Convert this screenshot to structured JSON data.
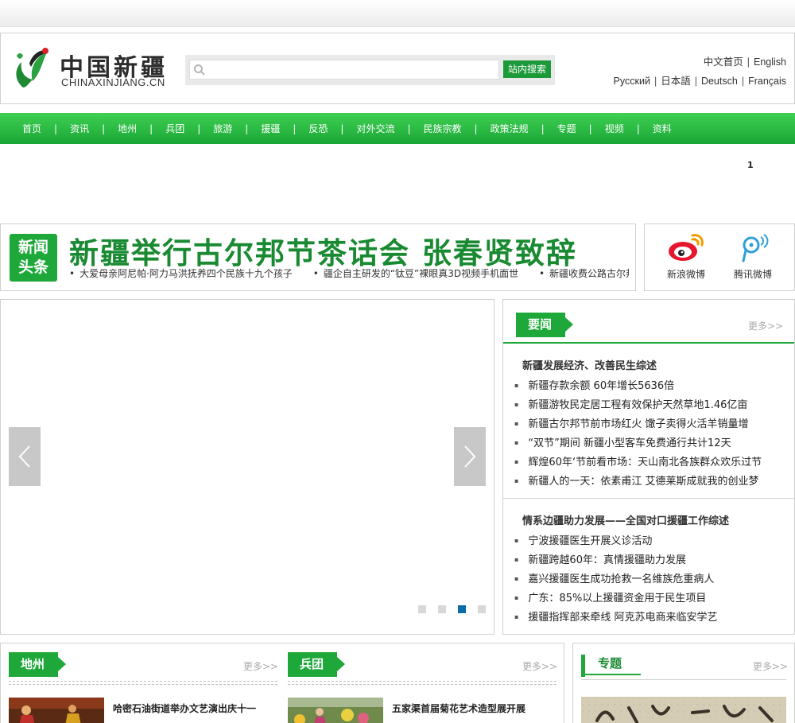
{
  "header": {
    "logo_cn": "中国新疆",
    "logo_en": "CHINAXINJIANG.CN",
    "search_button": "站内搜索",
    "search_placeholder": "",
    "lang_row1": [
      "中文首页",
      "English"
    ],
    "lang_row2": [
      "Русский",
      "日本語",
      "Deutsch",
      "Français"
    ]
  },
  "nav": [
    "首页",
    "资讯",
    "地州",
    "兵团",
    "旅游",
    "援疆",
    "反恐",
    "对外交流",
    "民族宗教",
    "政策法规",
    "专题",
    "视频",
    "资料"
  ],
  "pager": "1",
  "headline": {
    "badge_line1": "新闻",
    "badge_line2": "头条",
    "title": "新疆举行古尔邦节茶话会 张春贤致辞",
    "ticker": [
      "大爱母亲阿尼帕·阿力马洪抚养四个民族十九个孩子",
      "疆企自主研发的“钛豆”裸眼真3D视频手机面世",
      "新疆收费公路古尔邦节"
    ]
  },
  "weibo": {
    "sina": "新浪微博",
    "tencent": "腾讯微博"
  },
  "news": {
    "tab": "要闻",
    "more": "更多>>",
    "group1_title": "新疆发展经济、改善民生综述",
    "group1": [
      "新疆存款余额 60年增长5636倍",
      "新疆游牧民定居工程有效保护天然草地1.46亿亩",
      "新疆古尔邦节前市场红火 馓子卖得火活羊销量增",
      "“双节”期间 新疆小型客车免费通行共计12天",
      "辉煌60年‘节前看市场：天山南北各族群众欢乐过节",
      "新疆人的一天：依素甫江 艾德莱斯成就我的创业梦"
    ],
    "group2_title": "情系边疆助力发展——全国对口援疆工作综述",
    "group2": [
      "宁波援疆医生开展义诊活动",
      "新疆跨越60年：真情援疆助力发展",
      "嘉兴援疆医生成功抢救一名维族危重病人",
      "广东：85%以上援疆资金用于民生项目",
      "援疆指挥部来牵线 阿克苏电商来临安学艺"
    ]
  },
  "bottom": {
    "dizhou_tab": "地州",
    "dizhou_more": "更多>>",
    "dizhou_item": "哈密石油街道举办文艺演出庆十一",
    "bingtuan_tab": "兵团",
    "bingtuan_more": "更多>>",
    "bingtuan_item": "五家渠首届菊花艺术造型展开展",
    "zhuanti_tab": "专题",
    "zhuanti_more": "更多>>"
  },
  "colors": {
    "brand_green": "#1fa83a",
    "dot_active": "#0c6aa8"
  }
}
